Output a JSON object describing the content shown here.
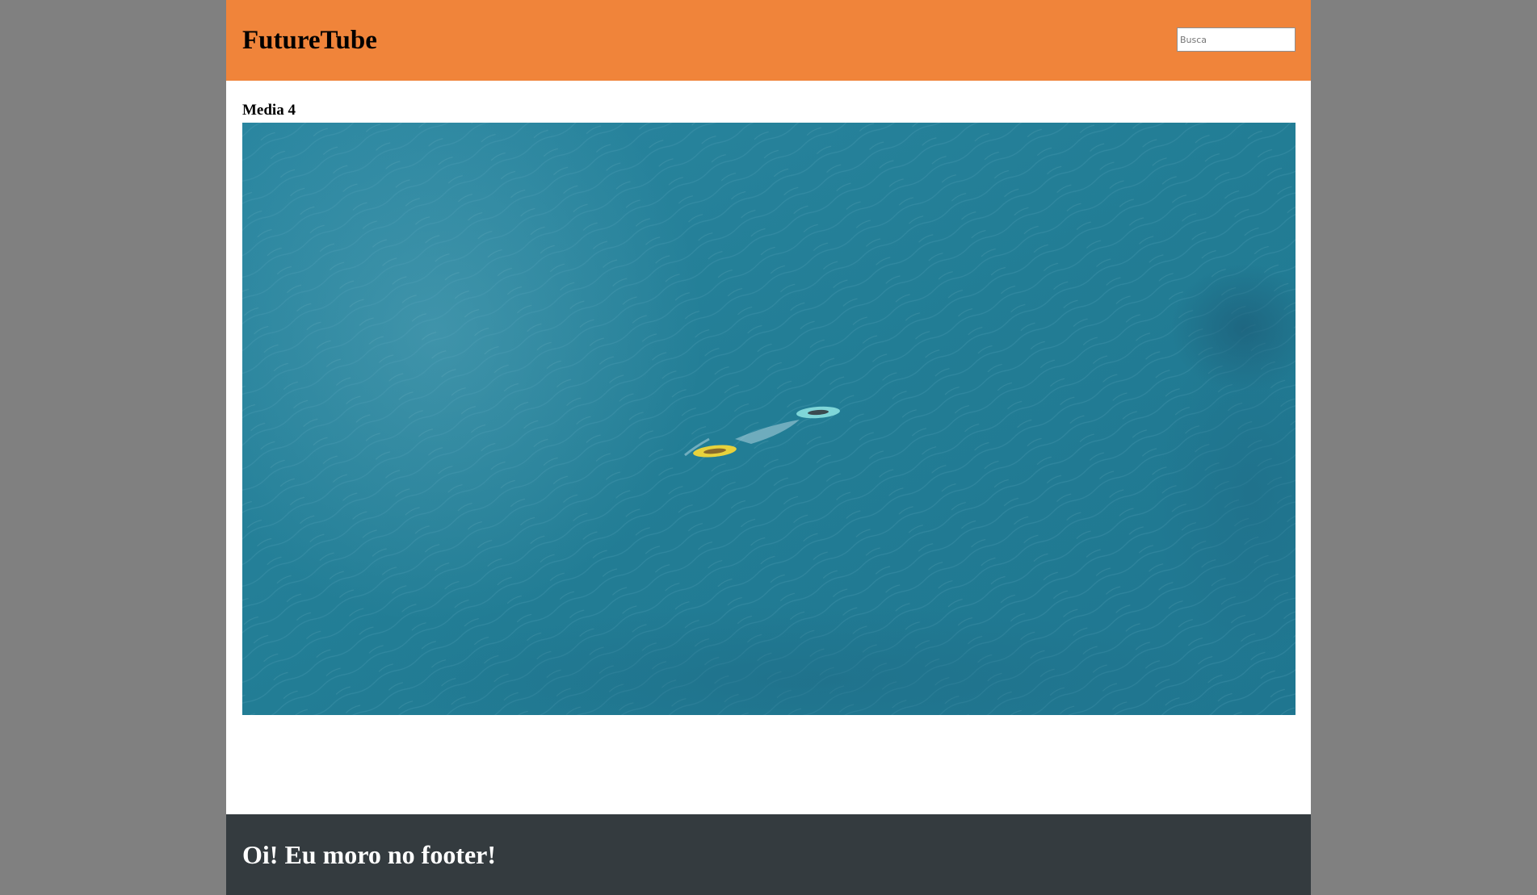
{
  "header": {
    "site_title": "FutureTube",
    "search": {
      "placeholder": "Busca",
      "value": ""
    }
  },
  "main": {
    "media_title": "Media 4",
    "video": {
      "description_icon": "aerial-ocean-kayaks-video-frame"
    }
  },
  "footer": {
    "text": "Oi! Eu moro no footer!"
  },
  "colors": {
    "page_background": "#808080",
    "header_background": "#f0843a",
    "footer_background": "#343b3f",
    "content_background": "#ffffff",
    "ocean": "#237f96"
  }
}
